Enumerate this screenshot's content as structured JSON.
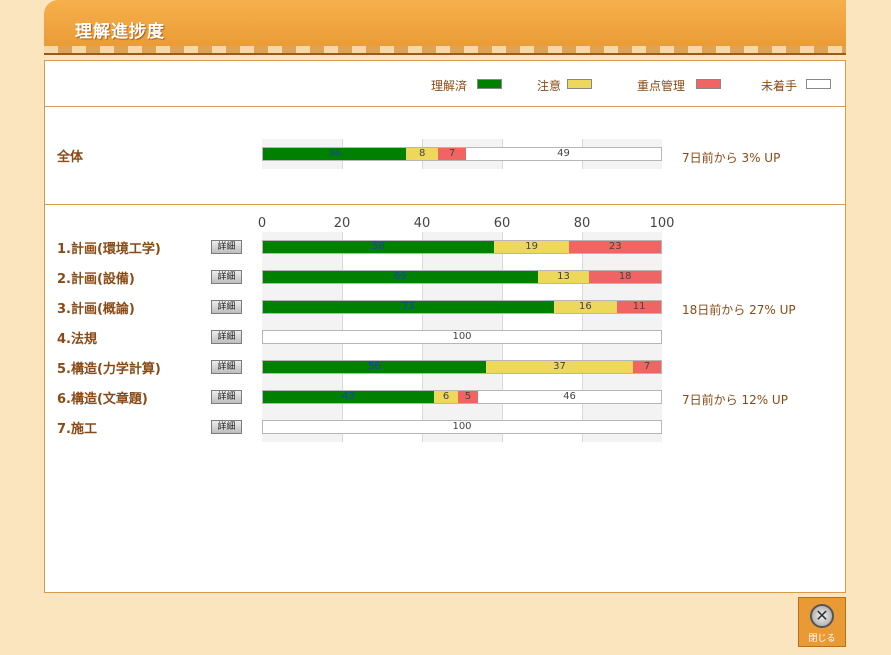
{
  "header": {
    "title": "理解進捗度"
  },
  "legend": [
    {
      "label": "理解済",
      "color": "#008000"
    },
    {
      "label": "注意",
      "color": "#eed85b"
    },
    {
      "label": "重点管理",
      "color": "#f06464"
    },
    {
      "label": "未着手",
      "color": "#ffffff"
    }
  ],
  "colors": {
    "understood": "#008000",
    "caution": "#eed85b",
    "priority": "#f06464",
    "untouched": "#ffffff",
    "accent": "#e99a35",
    "label_text": "#8a4a16"
  },
  "overall": {
    "label": "全体",
    "note": "7日前から 3% UP"
  },
  "detail_button_label": "詳細",
  "close_button": {
    "label": "閉じる",
    "icon": "close-icon"
  },
  "chart_data": {
    "type": "bar",
    "stacked": true,
    "orientation": "horizontal",
    "xlim": [
      0,
      100
    ],
    "xticks": [
      "0",
      "20",
      "40",
      "60",
      "80",
      "100"
    ],
    "grid": true,
    "categories": [
      "全体",
      "1.計画(環境工学)",
      "2.計画(設備)",
      "3.計画(概論)",
      "4.法規",
      "5.構造(力学計算)",
      "6.構造(文章題)",
      "7.施工"
    ],
    "series": [
      {
        "name": "理解済",
        "values": [
          36,
          58,
          69,
          73,
          0,
          56,
          43,
          0
        ]
      },
      {
        "name": "注意",
        "values": [
          8,
          19,
          13,
          16,
          0,
          37,
          6,
          0
        ]
      },
      {
        "name": "重点管理",
        "values": [
          7,
          23,
          18,
          11,
          0,
          7,
          5,
          0
        ]
      },
      {
        "name": "未着手",
        "values": [
          49,
          0,
          0,
          0,
          100,
          0,
          46,
          100
        ]
      }
    ],
    "data_labels": [
      [
        "36",
        "8",
        "7",
        "49"
      ],
      [
        "58",
        "19",
        "23",
        ""
      ],
      [
        "69",
        "13",
        "18",
        ""
      ],
      [
        "73",
        "16",
        "11",
        ""
      ],
      [
        "",
        "",
        "",
        "100"
      ],
      [
        "56",
        "37",
        "7",
        ""
      ],
      [
        "43",
        "6",
        "5",
        "46"
      ],
      [
        "",
        "",
        "",
        "100"
      ]
    ],
    "notes": [
      "7日前から 3% UP",
      "",
      "",
      "18日前から 27% UP",
      "",
      "",
      "7日前から 12% UP",
      ""
    ]
  },
  "subjects": [
    {
      "label": "1.計画(環境工学)",
      "note": ""
    },
    {
      "label": "2.計画(設備)",
      "note": ""
    },
    {
      "label": "3.計画(概論)",
      "note": "18日前から 27% UP"
    },
    {
      "label": "4.法規",
      "note": ""
    },
    {
      "label": "5.構造(力学計算)",
      "note": ""
    },
    {
      "label": "6.構造(文章題)",
      "note": "7日前から 12% UP"
    },
    {
      "label": "7.施工",
      "note": ""
    }
  ]
}
